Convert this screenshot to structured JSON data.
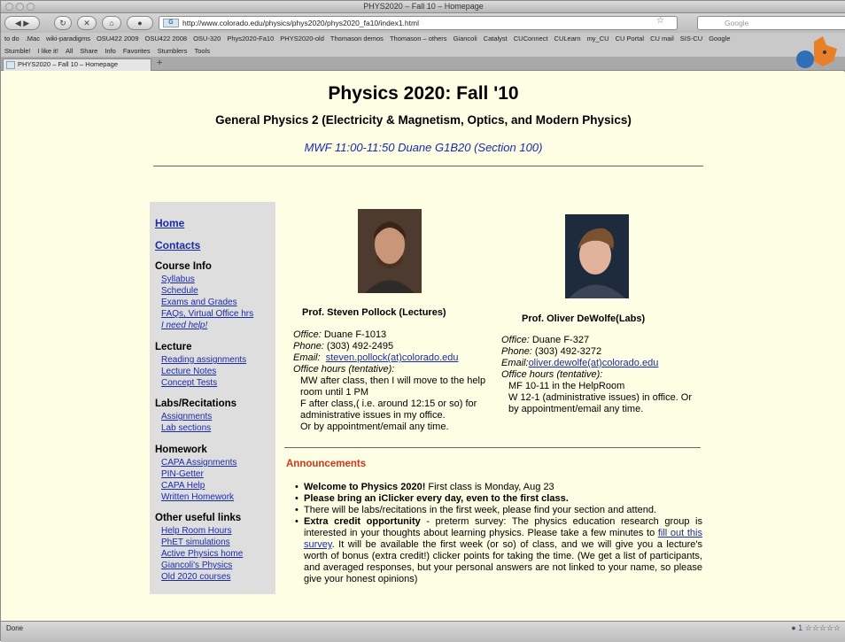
{
  "window": {
    "title": "PHYS2020 – Fall 10 – Homepage"
  },
  "nav": {
    "url": "http://www.colorado.edu/physics/phys2020/phys2020_fa10/index1.html",
    "favicon_text": "G",
    "search_placeholder": "Google"
  },
  "bookmarks": [
    "to do",
    ".Mac",
    "wiki-paradigms",
    "OSU422 2009",
    "OSU422 2008",
    "OSU-320",
    "Phys2020-Fa10",
    "PHYS2020-old",
    "Thomason demos",
    "Thomason – others",
    "Giancoli",
    "Catalyst",
    "CUConnect",
    "CULearn",
    "my_CU",
    "CU Portal",
    "CU mail",
    "SIS-CU",
    "Google"
  ],
  "stumble": [
    "Stumble!",
    "I like it!",
    "All",
    "Share",
    "Info",
    "Favorites",
    "Stumblers",
    "Tools"
  ],
  "tab": {
    "label": "PHYS2020 – Fall 10 – Homepage",
    "new_tab": "+"
  },
  "page": {
    "title": "Physics 2020: Fall '10",
    "subtitle": "General Physics 2 (Electricity & Magnetism, Optics, and Modern Physics)",
    "schedule": "MWF 11:00-11:50 Duane G1B20 (Section 100)"
  },
  "sidebar": {
    "home": "Home",
    "contacts": "Contacts",
    "sections": [
      {
        "title": "Course Info",
        "links": [
          "Syllabus",
          "Schedule",
          "Exams and Grades",
          "FAQs, Virtual Office hrs",
          "I need help!"
        ]
      },
      {
        "title": "Lecture",
        "links": [
          "Reading assignments",
          "Lecture Notes",
          "Concept Tests"
        ]
      },
      {
        "title": "Labs/Recitations",
        "links": [
          "Assignments",
          "Lab sections"
        ]
      },
      {
        "title": "Homework",
        "links": [
          "CAPA Assignments",
          "PIN-Getter",
          "CAPA Help",
          "Written Homework"
        ]
      },
      {
        "title": "Other useful links",
        "links": [
          "Help Room Hours",
          "PhET simulations",
          "Active Physics home",
          "Giancoli's Physics",
          "Old 2020 courses"
        ]
      }
    ]
  },
  "profs": [
    {
      "name": "Prof. Steven Pollock (Lectures)",
      "office_label": "Office:",
      "office": " Duane F-1013",
      "phone_label": "Phone:",
      "phone": " (303) 492-2495",
      "email_label": "Email:",
      "email": "steven.pollock(at)colorado.edu",
      "hours_label": "Office hours (tentative):",
      "hours": [
        "MW after class, then I will move to the help room until 1 PM",
        "F after class,( i.e. around 12:15 or so) for administrative issues in my office.",
        "Or by appointment/email any time."
      ]
    },
    {
      "name": "Prof. Oliver DeWolfe(Labs)",
      "office_label": "Office:",
      "office": " Duane F-327",
      "phone_label": "Phone:",
      "phone": " (303) 492-3272",
      "email_label": "Email:",
      "email": "oliver.dewolfe(at)colorado.edu",
      "hours_label": "Office hours (tentative):",
      "hours": [
        "MF 10-11 in the HelpRoom",
        "W 12-1 (administrative issues) in office. Or by appointment/email any time."
      ]
    }
  ],
  "announcements": {
    "title": "Announcements",
    "items": [
      {
        "bold": "Welcome to Physics 2020!",
        "text": " First class is Monday, Aug 23"
      },
      {
        "bold": "Please bring an iClicker every day, even to the first class.",
        "text": ""
      },
      {
        "bold": "",
        "text": "There will be labs/recitations in the first week, please find your section and attend."
      },
      {
        "bold": "Extra credit opportunity",
        "text": " - preterm survey: The physics education research group is interested in your thoughts about learning physics. Please take a few minutes to ",
        "link": "fill out this survey",
        "text2": ". It will be available the first week (or so) of class, and we will give you a lecture's worth of bonus (extra credit!) clicker points for taking the time. (We get a list of participants, and averaged responses, but your personal answers are not linked to your name, so please give your honest opinions)"
      }
    ]
  },
  "status": {
    "text": "Done",
    "right": "1"
  },
  "colors": {
    "page_bg": "#fefee4",
    "link": "#1a2baa",
    "announce": "#d5331a",
    "sidebar_bg": "#dedede"
  }
}
